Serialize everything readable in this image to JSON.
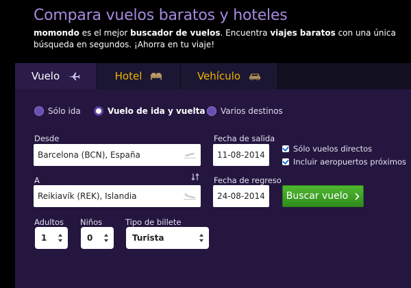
{
  "hero": {
    "title": "Compara vuelos baratos y hoteles",
    "sub_parts": [
      "momondo",
      " es el mejor ",
      "buscador de vuelos",
      ". Encuentra ",
      "viajes baratos",
      " con una única búsqueda en segundos. ¡Ahorra en tu viaje!"
    ]
  },
  "tabs": [
    {
      "label": "Vuelo",
      "icon": "airplane-icon"
    },
    {
      "label": "Hotel",
      "icon": "bed-icon"
    },
    {
      "label": "Vehículo",
      "icon": "car-icon"
    }
  ],
  "trip_type": [
    {
      "label": "Sólo ida",
      "selected": false
    },
    {
      "label": "Vuelo de ida y vuelta",
      "selected": true
    },
    {
      "label": "Varios destinos",
      "selected": false
    }
  ],
  "form": {
    "from_label": "Desde",
    "from_value": "Barcelona (BCN), España",
    "to_label": "A",
    "to_value": "Reikiavík (REK), Islandia",
    "swap_icon": "swap-arrows-icon",
    "depart_label": "Fecha de salida",
    "depart_value": "11-08-2014",
    "return_label": "Fecha de regreso",
    "return_value": "24-08-2014",
    "direct_label": "Sólo vuelos directos",
    "direct_checked": true,
    "nearby_label": "Incluir aeropuertos próximos",
    "nearby_checked": true,
    "search_label": "Buscar vuelo",
    "search_icon": "chevron-right-icon",
    "adults_label": "Adultos",
    "adults_value": "1",
    "children_label": "Niños",
    "children_value": "0",
    "ticket_label": "Tipo de billete",
    "ticket_value": "Turista"
  },
  "colors": {
    "accent_title": "#a48be0",
    "tab_inactive": "#f0b400",
    "panel_bg": "#24163e",
    "button_green": "#3fa226"
  }
}
